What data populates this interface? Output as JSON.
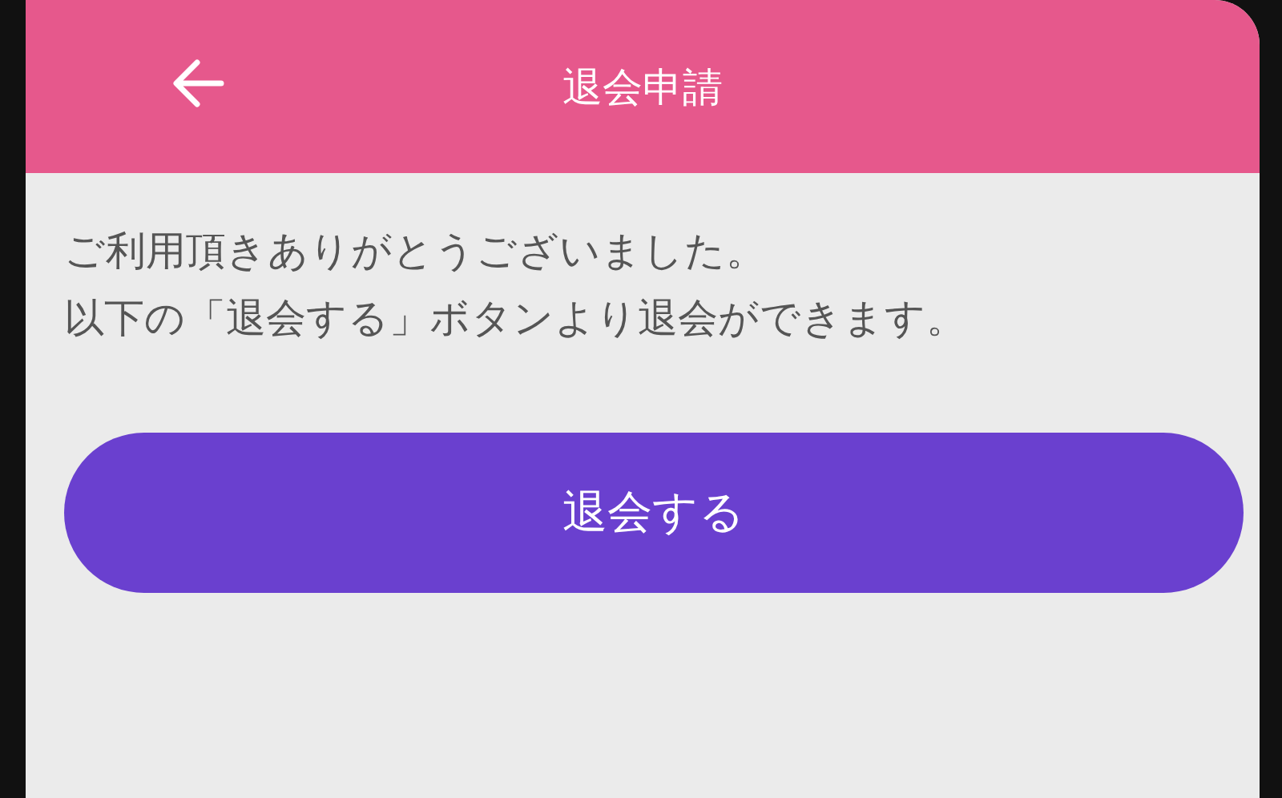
{
  "header": {
    "title": "退会申請"
  },
  "message": [
    "ご利用頂きありがとうございました。",
    "以下の「退会する」ボタンより退会ができます。"
  ],
  "button": {
    "label": "退会する"
  }
}
